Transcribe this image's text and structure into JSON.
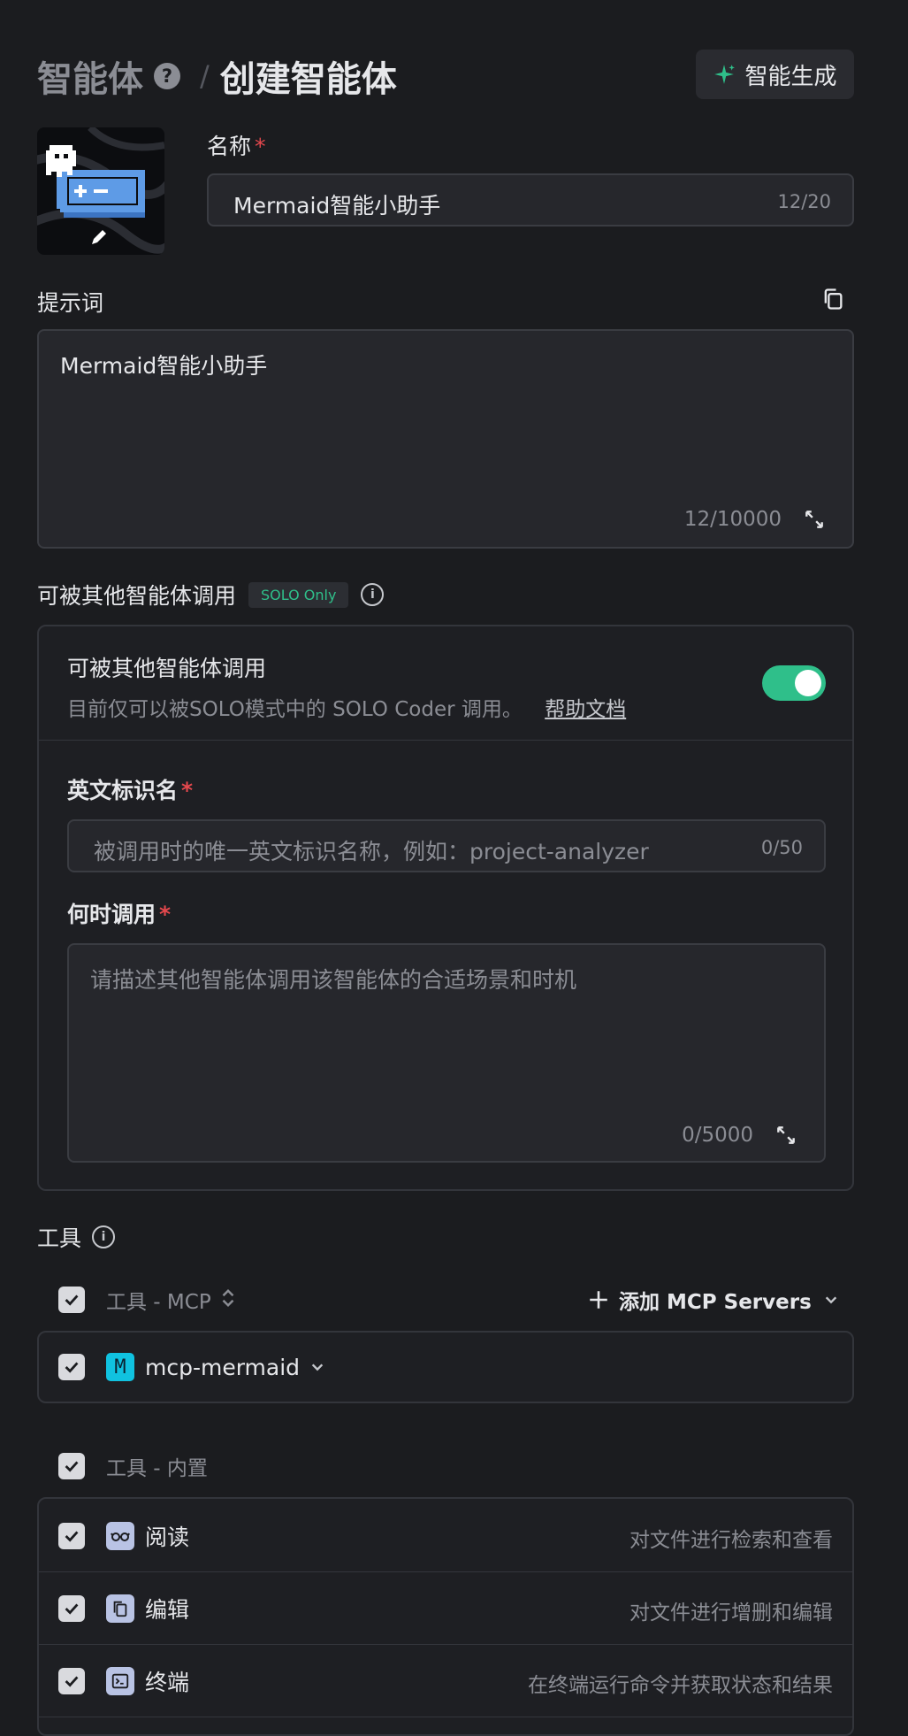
{
  "header": {
    "breadcrumb_root": "智能体",
    "separator": "/",
    "page_title": "创建智能体",
    "generate_button": "智能生成"
  },
  "name_field": {
    "label": "名称",
    "required_mark": "*",
    "value": "Mermaid智能小助手",
    "counter": "12/20"
  },
  "prompt": {
    "label": "提示词",
    "value": "Mermaid智能小助手",
    "counter": "12/10000"
  },
  "callable": {
    "section_title": "可被其他智能体调用",
    "badge": "SOLO Only",
    "card_title": "可被其他智能体调用",
    "card_desc": "目前仅可以被SOLO模式中的 SOLO Coder 调用。",
    "help_link": "帮助文档",
    "toggle_on": true,
    "id_label": "英文标识名",
    "id_placeholder": "被调用时的唯一英文标识名称，例如：project-analyzer",
    "id_counter": "0/50",
    "when_label": "何时调用",
    "when_placeholder": "请描述其他智能体调用该智能体的合适场景和时机",
    "when_counter": "0/5000"
  },
  "tools": {
    "section_title": "工具",
    "mcp_group_label": "工具 - MCP",
    "add_mcp_label": "添加 MCP Servers",
    "mcp_items": [
      {
        "icon_letter": "M",
        "name": "mcp-mermaid"
      }
    ],
    "builtin_group_label": "工具 - 内置",
    "builtin_items": [
      {
        "name": "阅读",
        "desc": "对文件进行检索和查看",
        "icon": "glasses-icon"
      },
      {
        "name": "编辑",
        "desc": "对文件进行增删和编辑",
        "icon": "copy-file-icon"
      },
      {
        "name": "终端",
        "desc": "在终端运行命令并获取状态和结果",
        "icon": "terminal-icon"
      }
    ]
  },
  "colors": {
    "accent_green": "#2fbf8a",
    "mcp_icon_bg": "#10c2e0",
    "required_red": "#e5484d"
  }
}
